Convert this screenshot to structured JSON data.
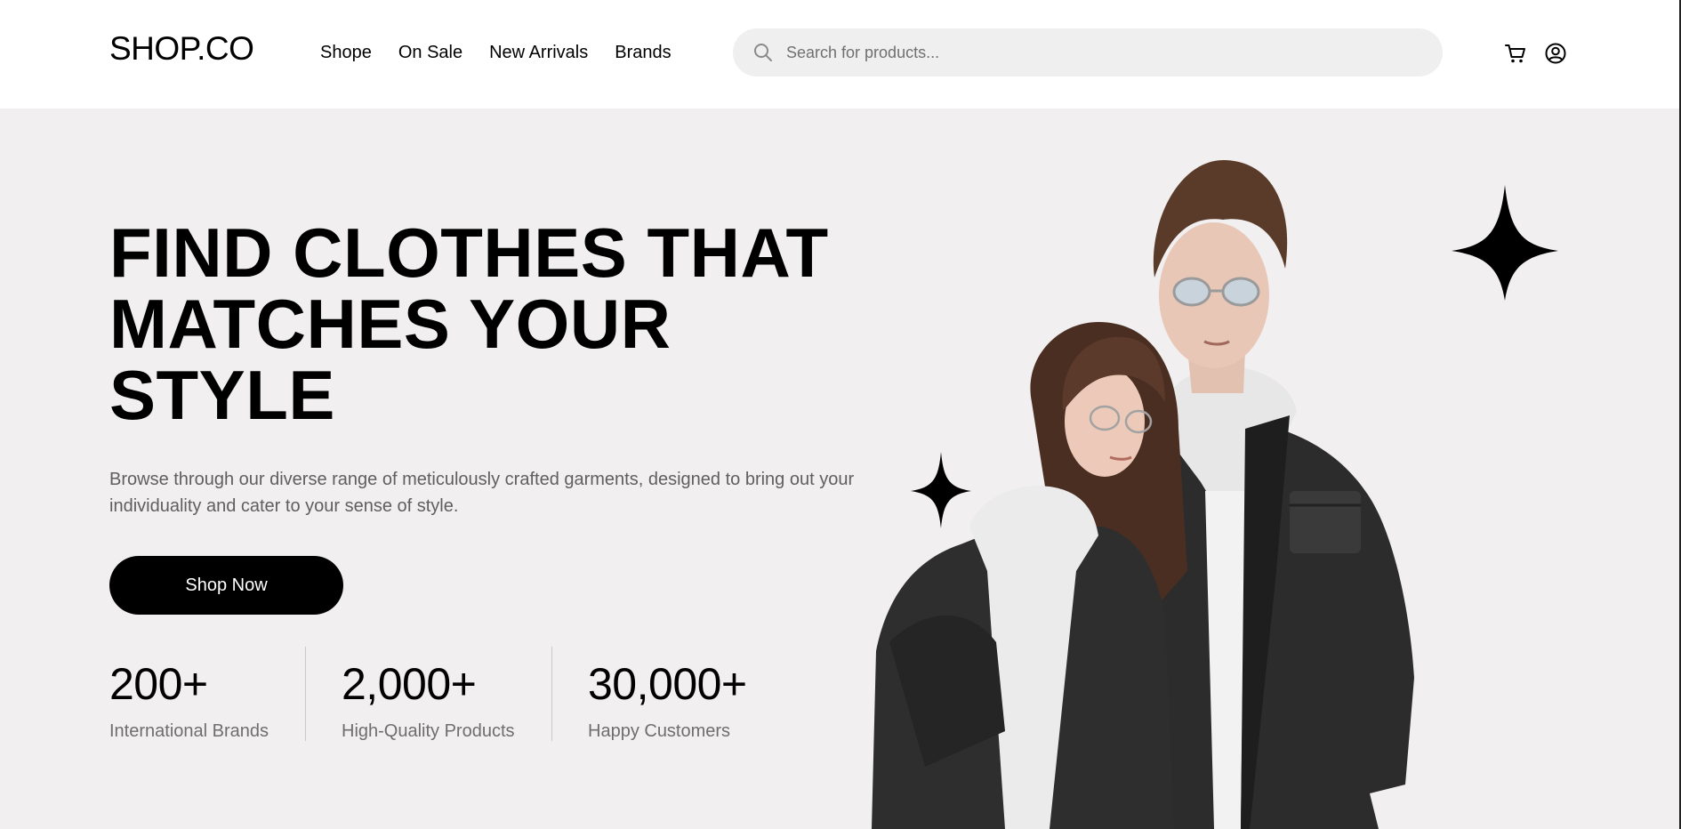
{
  "header": {
    "logo": "SHOP.CO",
    "nav": [
      "Shope",
      "On Sale",
      "New Arrivals",
      "Brands"
    ],
    "search_placeholder": "Search for products...",
    "icons": [
      "search-icon",
      "cart-icon",
      "account-icon"
    ]
  },
  "hero": {
    "headline_lines": [
      "FIND CLOTHES THAT",
      "MATCHES YOUR",
      "STYLE"
    ],
    "description": "Browse through our diverse range of meticulously crafted garments, designed to bring out your individuality and cater to your sense of style.",
    "cta_label": "Shop Now",
    "stats": [
      {
        "value": "200+",
        "label": "International Brands"
      },
      {
        "value": "2,000+",
        "label": "High-Quality Products"
      },
      {
        "value": "30,000+",
        "label": "Happy Customers"
      }
    ]
  },
  "colors": {
    "hero_background": "#f1eff0",
    "primary": "#000000",
    "search_background": "#efefef",
    "muted_text": "#5f5f5f"
  }
}
